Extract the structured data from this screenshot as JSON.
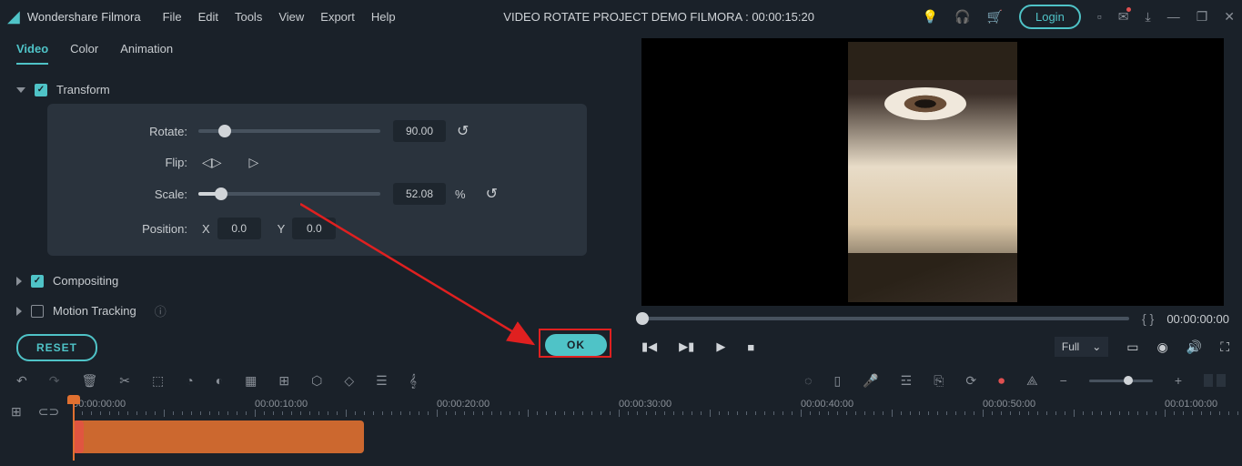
{
  "app": {
    "name": "Wondershare Filmora"
  },
  "menu": {
    "file": "File",
    "edit": "Edit",
    "tools": "Tools",
    "view": "View",
    "export": "Export",
    "help": "Help"
  },
  "title": "VIDEO ROTATE PROJECT DEMO FILMORA : 00:00:15:20",
  "login": "Login",
  "tabs": {
    "video": "Video",
    "color": "Color",
    "animation": "Animation"
  },
  "sections": {
    "transform": "Transform",
    "compositing": "Compositing",
    "motion_tracking": "Motion Tracking"
  },
  "transform": {
    "rotate_label": "Rotate:",
    "rotate_val": "90.00",
    "flip_label": "Flip:",
    "scale_label": "Scale:",
    "scale_val": "52.08",
    "scale_unit": "%",
    "position_label": "Position:",
    "x_label": "X",
    "x_val": "0.0",
    "y_label": "Y",
    "y_val": "0.0"
  },
  "buttons": {
    "reset": "RESET",
    "ok": "OK"
  },
  "preview": {
    "quality_label": "Full",
    "timecode": "00:00:00:00",
    "brace_l": "{",
    "brace_r": "}"
  },
  "timeline": {
    "labels": [
      "00:00:00:00",
      "00:00:10:00",
      "00:00:20:00",
      "00:00:30:00",
      "00:00:40:00",
      "00:00:50:00",
      "00:01:00:00"
    ]
  }
}
